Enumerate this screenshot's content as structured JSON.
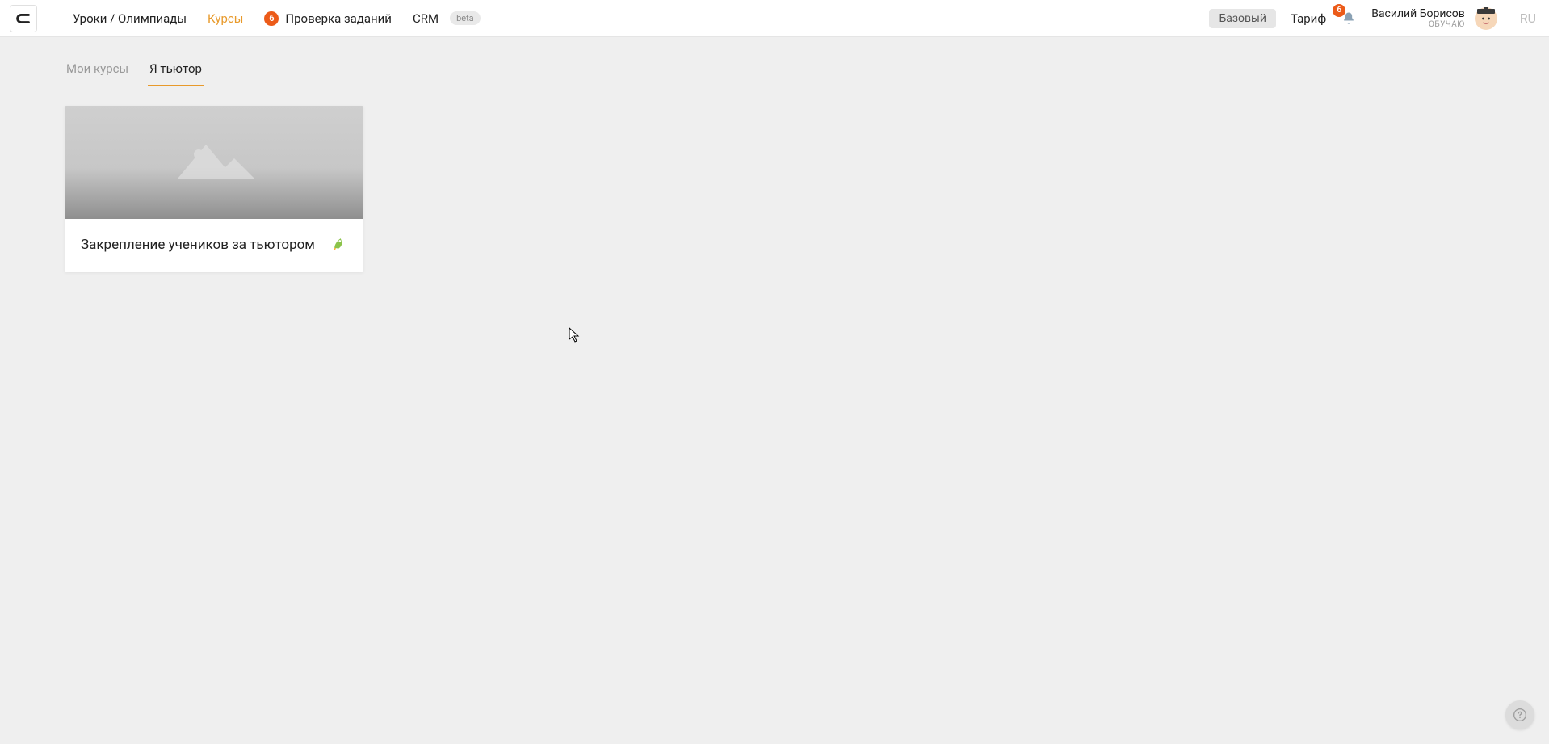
{
  "header": {
    "nav": {
      "lessons": "Уроки / Олимпиады",
      "courses": "Курсы",
      "assignments_badge": "6",
      "assignments": "Проверка заданий",
      "crm": "CRM",
      "crm_badge": "beta"
    },
    "plan_chip": "Базовый",
    "tariff": "Тариф",
    "notifications_count": "6",
    "user": {
      "name": "Василий Борисов",
      "role": "ОБУЧАЮ"
    },
    "lang": "RU"
  },
  "tabs": {
    "my_courses": "Мои курсы",
    "tutor": "Я тьютор"
  },
  "cards": [
    {
      "title": "Закрепление учеников за тьютором"
    }
  ]
}
